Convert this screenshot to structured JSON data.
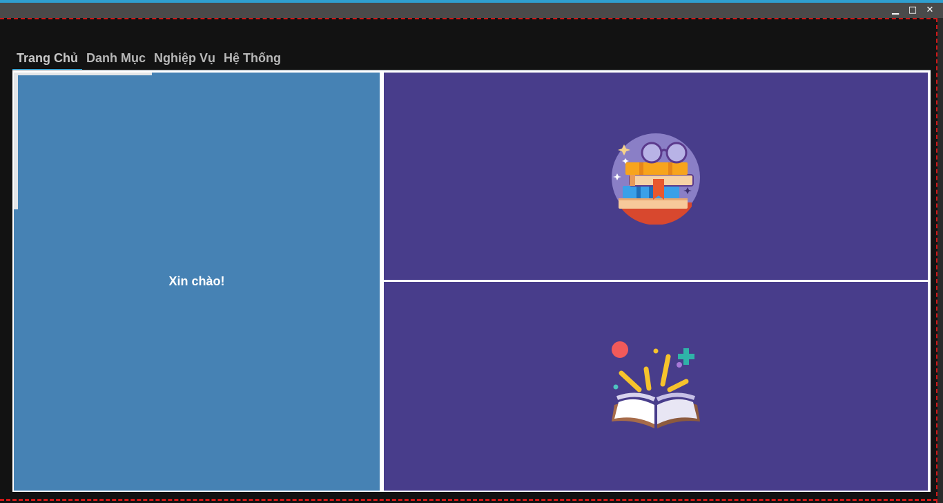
{
  "window": {
    "minimize_icon": "minimize-icon",
    "maximize_icon": "maximize-icon",
    "close_icon": "close-icon"
  },
  "menu": {
    "tabs": [
      {
        "label": "Trang Chủ",
        "active": true
      },
      {
        "label": "Danh Mục",
        "active": false
      },
      {
        "label": "Nghiệp Vụ",
        "active": false
      },
      {
        "label": "Hệ Thống",
        "active": false
      }
    ]
  },
  "home": {
    "greeting": "Xin chào!",
    "top_image": "books-stack-illustration",
    "bottom_image": "open-book-illustration"
  },
  "colors": {
    "accent": "#2fa3d8",
    "left_panel": "#4682b4",
    "right_panel": "#483d8b",
    "window_bg": "#121212",
    "frame_dash": "#d01818"
  }
}
